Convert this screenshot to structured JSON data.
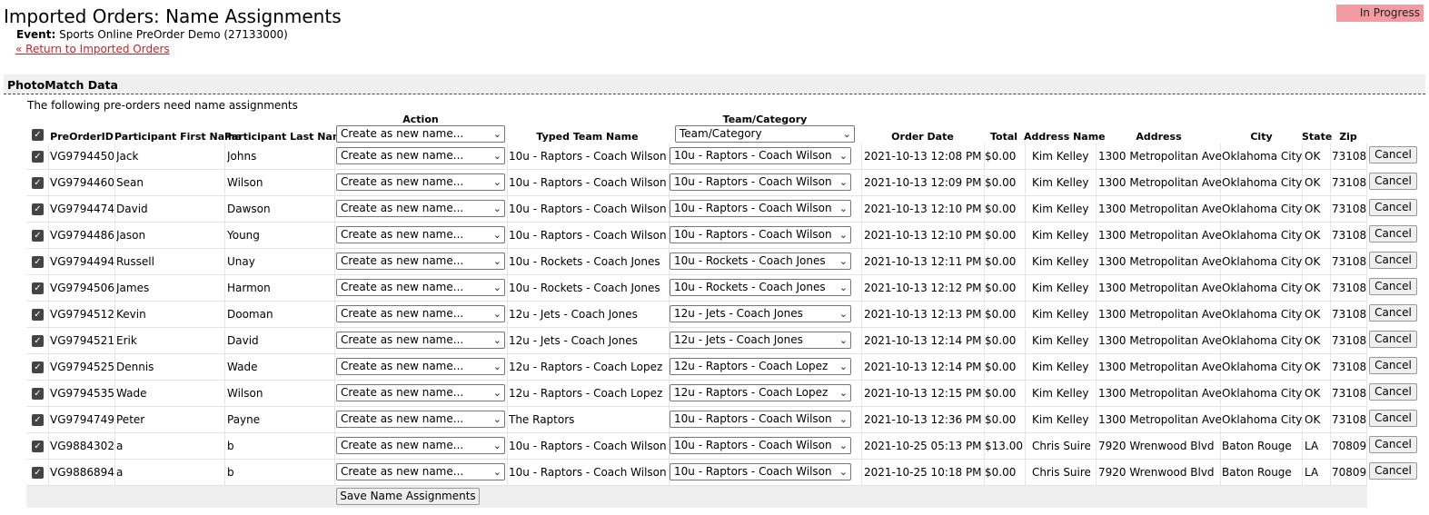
{
  "page": {
    "title": "Imported Orders: Name Assignments",
    "event_label": "Event:",
    "event_value": "Sports Online PreOrder Demo (27133000)",
    "return_link": "« Return to Imported Orders",
    "status": "In Progress"
  },
  "section": {
    "title": "PhotoMatch Data",
    "intro": "The following pre-orders need name assignments"
  },
  "table": {
    "headers": {
      "preorder_id": "PreOrderID",
      "first_name": "Participant First Name",
      "last_name": "Participant Last Name",
      "action": "Action",
      "typed_team": "Typed Team Name",
      "team_category": "Team/Category",
      "order_date": "Order Date",
      "total": "Total",
      "address_name": "Address Name",
      "address": "Address",
      "city": "City",
      "state": "State",
      "zip": "Zip"
    },
    "header_action_select": "Create as new name...",
    "header_team_select": "Team/Category",
    "cancel_label": "Cancel",
    "rows": [
      {
        "id": "VG9794450",
        "first": "Jack",
        "last": "Johns",
        "action": "Create as new name...",
        "typed": "10u - Raptors - Coach Wilson",
        "team": "10u - Raptors - Coach Wilson",
        "date": "2021-10-13 12:08 PM",
        "total": "$0.00",
        "addr_name": "Kim Kelley",
        "address": "1300 Metropolitan Ave",
        "city": "Oklahoma City",
        "state": "OK",
        "zip": "73108"
      },
      {
        "id": "VG9794460",
        "first": "Sean",
        "last": "Wilson",
        "action": "Create as new name...",
        "typed": "10u - Raptors - Coach Wilson",
        "team": "10u - Raptors - Coach Wilson",
        "date": "2021-10-13 12:09 PM",
        "total": "$0.00",
        "addr_name": "Kim Kelley",
        "address": "1300 Metropolitan Ave",
        "city": "Oklahoma City",
        "state": "OK",
        "zip": "73108"
      },
      {
        "id": "VG9794474",
        "first": "David",
        "last": "Dawson",
        "action": "Create as new name...",
        "typed": "10u - Raptors - Coach Wilson",
        "team": "10u - Raptors - Coach Wilson",
        "date": "2021-10-13 12:10 PM",
        "total": "$0.00",
        "addr_name": "Kim Kelley",
        "address": "1300 Metropolitan Ave",
        "city": "Oklahoma City",
        "state": "OK",
        "zip": "73108"
      },
      {
        "id": "VG9794486",
        "first": "Jason",
        "last": "Young",
        "action": "Create as new name...",
        "typed": "10u - Raptors - Coach Wilson",
        "team": "10u - Raptors - Coach Wilson",
        "date": "2021-10-13 12:10 PM",
        "total": "$0.00",
        "addr_name": "Kim Kelley",
        "address": "1300 Metropolitan Ave",
        "city": "Oklahoma City",
        "state": "OK",
        "zip": "73108"
      },
      {
        "id": "VG9794494",
        "first": "Russell",
        "last": "Unay",
        "action": "Create as new name...",
        "typed": "10u - Rockets - Coach Jones",
        "team": "10u - Rockets - Coach Jones",
        "date": "2021-10-13 12:11 PM",
        "total": "$0.00",
        "addr_name": "Kim Kelley",
        "address": "1300 Metropolitan Ave",
        "city": "Oklahoma City",
        "state": "OK",
        "zip": "73108"
      },
      {
        "id": "VG9794506",
        "first": "James",
        "last": "Harmon",
        "action": "Create as new name...",
        "typed": "10u - Rockets - Coach Jones",
        "team": "10u - Rockets - Coach Jones",
        "date": "2021-10-13 12:12 PM",
        "total": "$0.00",
        "addr_name": "Kim Kelley",
        "address": "1300 Metropolitan Ave",
        "city": "Oklahoma City",
        "state": "OK",
        "zip": "73108"
      },
      {
        "id": "VG9794512",
        "first": "Kevin",
        "last": "Dooman",
        "action": "Create as new name...",
        "typed": "12u - Jets - Coach Jones",
        "team": "12u - Jets - Coach Jones",
        "date": "2021-10-13 12:13 PM",
        "total": "$0.00",
        "addr_name": "Kim Kelley",
        "address": "1300 Metropolitan Ave",
        "city": "Oklahoma City",
        "state": "OK",
        "zip": "73108"
      },
      {
        "id": "VG9794521",
        "first": "Erik",
        "last": "David",
        "action": "Create as new name...",
        "typed": "12u - Jets - Coach Jones",
        "team": "12u - Jets - Coach Jones",
        "date": "2021-10-13 12:14 PM",
        "total": "$0.00",
        "addr_name": "Kim Kelley",
        "address": "1300 Metropolitan Ave",
        "city": "Oklahoma City",
        "state": "OK",
        "zip": "73108"
      },
      {
        "id": "VG9794525",
        "first": "Dennis",
        "last": "Wade",
        "action": "Create as new name...",
        "typed": "12u - Raptors - Coach Lopez",
        "team": "12u - Raptors - Coach Lopez",
        "date": "2021-10-13 12:14 PM",
        "total": "$0.00",
        "addr_name": "Kim Kelley",
        "address": "1300 Metropolitan Ave",
        "city": "Oklahoma City",
        "state": "OK",
        "zip": "73108"
      },
      {
        "id": "VG9794535",
        "first": "Wade",
        "last": "Wilson",
        "action": "Create as new name...",
        "typed": "12u - Raptors - Coach Lopez",
        "team": "12u - Raptors - Coach Lopez",
        "date": "2021-10-13 12:15 PM",
        "total": "$0.00",
        "addr_name": "Kim Kelley",
        "address": "1300 Metropolitan Ave",
        "city": "Oklahoma City",
        "state": "OK",
        "zip": "73108"
      },
      {
        "id": "VG9794749",
        "first": "Peter",
        "last": "Payne",
        "action": "Create as new name...",
        "typed": "The Raptors",
        "team": "10u - Raptors - Coach Wilson",
        "date": "2021-10-13 12:36 PM",
        "total": "$0.00",
        "addr_name": "Kim Kelley",
        "address": "1300 Metropolitan Ave",
        "city": "Oklahoma City",
        "state": "OK",
        "zip": "73108"
      },
      {
        "id": "VG9884302",
        "first": "a",
        "last": "b",
        "action": "Create as new name...",
        "typed": "10u - Raptors - Coach Wilson",
        "team": "10u - Raptors - Coach Wilson",
        "date": "2021-10-25 05:13 PM",
        "total": "$13.00",
        "addr_name": "Chris Suire",
        "address": "7920 Wrenwood Blvd",
        "city": "Baton Rouge",
        "state": "LA",
        "zip": "70809"
      },
      {
        "id": "VG9886894",
        "first": "a",
        "last": "b",
        "action": "Create as new name...",
        "typed": "10u - Raptors - Coach Wilson",
        "team": "10u - Raptors - Coach Wilson",
        "date": "2021-10-25 10:18 PM",
        "total": "$0.00",
        "addr_name": "Chris Suire",
        "address": "7920 Wrenwood Blvd",
        "city": "Baton Rouge",
        "state": "LA",
        "zip": "70809"
      }
    ],
    "save_button": "Save Name Assignments"
  },
  "icons": {
    "checkbox": "checkmark-icon",
    "dropdown": "chevron-down-icon"
  }
}
